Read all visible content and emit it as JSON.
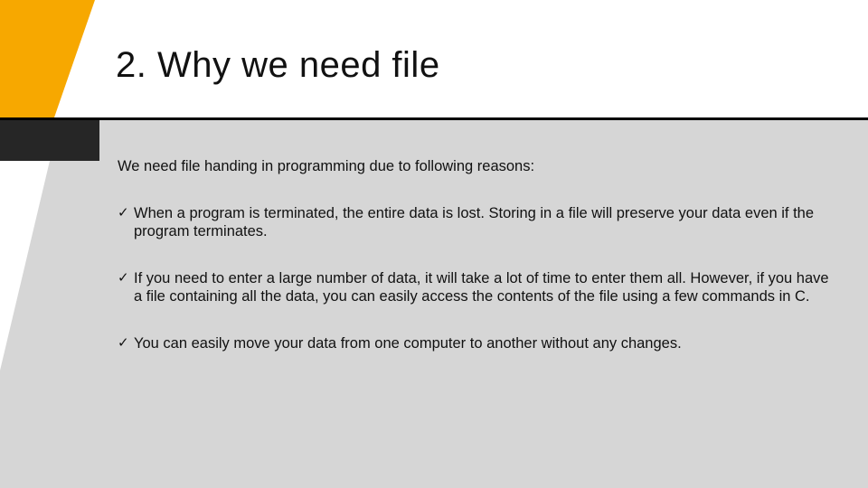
{
  "title": "2. Why we need file",
  "intro": "We need file handing in programming due to following reasons:",
  "bullets": [
    "When a program is terminated, the entire data is lost. Storing in a file will preserve your data even if the program terminates.",
    "If you need to enter a large number of data, it will take a lot of time to enter them all. However, if you have a file containing all the data, you can easily access the contents of the file using a few commands in C.",
    "You can easily move your data from one computer to another without any changes."
  ],
  "colors": {
    "accent": "#f7a800",
    "dark": "#262626",
    "body_bg": "#d6d6d6"
  }
}
